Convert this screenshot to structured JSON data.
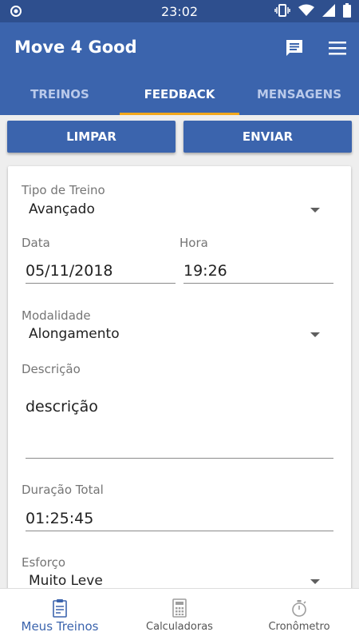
{
  "status_bar": {
    "time": "23:02"
  },
  "app_bar": {
    "title": "Move 4 Good"
  },
  "tabs": [
    {
      "label": "TREINOS"
    },
    {
      "label": "FEEDBACK"
    },
    {
      "label": "MENSAGENS"
    }
  ],
  "actions": {
    "clear_label": "LIMPAR",
    "send_label": "ENVIAR"
  },
  "form": {
    "training_type_label": "Tipo de Treino",
    "training_type_value": "Avançado",
    "date_label": "Data",
    "date_value": "05/11/2018",
    "time_label": "Hora",
    "time_value": "19:26",
    "modality_label": "Modalidade",
    "modality_value": "Alongamento",
    "description_label": "Descrição",
    "description_value": "descrição",
    "duration_label": "Duração Total",
    "duration_value": "01:25:45",
    "effort_label": "Esforço",
    "effort_value": "Muito Leve"
  },
  "bottom_nav": [
    {
      "label": "Meus Treinos",
      "icon": "clipboard-icon"
    },
    {
      "label": "Calculadoras",
      "icon": "calculator-icon"
    },
    {
      "label": "Cronômetro",
      "icon": "stopwatch-icon"
    }
  ],
  "colors": {
    "primary": "#3b64ad",
    "status_bar": "#2e4f8e",
    "tab_indicator": "#f2a71b"
  }
}
